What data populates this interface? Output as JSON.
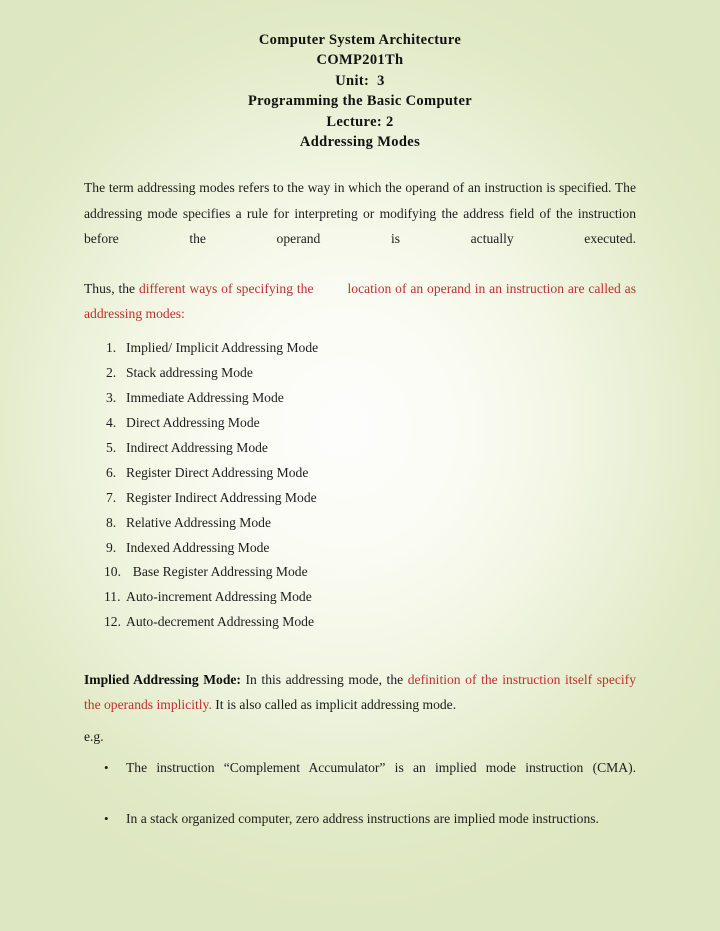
{
  "header": {
    "lines": [
      "Computer System Architecture",
      "COMP201Th",
      "Unit:  3",
      "Programming the Basic Computer",
      "Lecture: 2",
      "Addressing Modes"
    ]
  },
  "intro_paragraph": "The term addressing modes refers to the way in which the operand of an instruction is specified. The addressing mode specifies a rule for interpreting or modifying the address field of the instruction before the operand is actually executed.",
  "thus_paragraph": {
    "lead": "Thus, the ",
    "red_part_1": "different ways of specifying the",
    "red_part_2": "location of an operand in an instruction are called as addressing modes",
    "trailing": ":"
  },
  "modes_list": [
    {
      "number": "1.",
      "label": "Implied/ Implicit Addressing Mode"
    },
    {
      "number": "2.",
      "label": "Stack addressing Mode"
    },
    {
      "number": "3.",
      "label": "Immediate Addressing Mode"
    },
    {
      "number": "4.",
      "label": "Direct Addressing Mode"
    },
    {
      "number": "5.",
      "label": "Indirect Addressing Mode"
    },
    {
      "number": "6.",
      "label": "Register Direct Addressing Mode"
    },
    {
      "number": "7.",
      "label": "Register Indirect Addressing Mode"
    },
    {
      "number": "8.",
      "label": "Relative Addressing Mode"
    },
    {
      "number": "9.",
      "label": "Indexed Addressing Mode"
    },
    {
      "number": "10.",
      "label": "  Base Register Addressing Mode"
    },
    {
      "number": "11.",
      "label": "Auto-increment Addressing Mode"
    },
    {
      "number": "12.",
      "label": "Auto-decrement Addressing Mode"
    }
  ],
  "implied_section": {
    "title": "Implied Addressing Mode:",
    "text_before_red": " In this addressing mode, the ",
    "red_text": "definition of the instruction itself specify the operands implicitly.",
    "text_after_red": " It is also called as implicit addressing mode.",
    "eg_label": "e.g."
  },
  "examples": [
    "The instruction “Complement Accumulator” is an implied mode instruction (CMA).",
    "In a stack organized computer, zero address instructions are implied mode instructions."
  ],
  "colors": {
    "accent_red": "#bf3030",
    "body_text": "#1d1d1d",
    "page_edge": "#dde7c1",
    "page_center": "#fdfdfb"
  },
  "bullet_glyph": "•"
}
